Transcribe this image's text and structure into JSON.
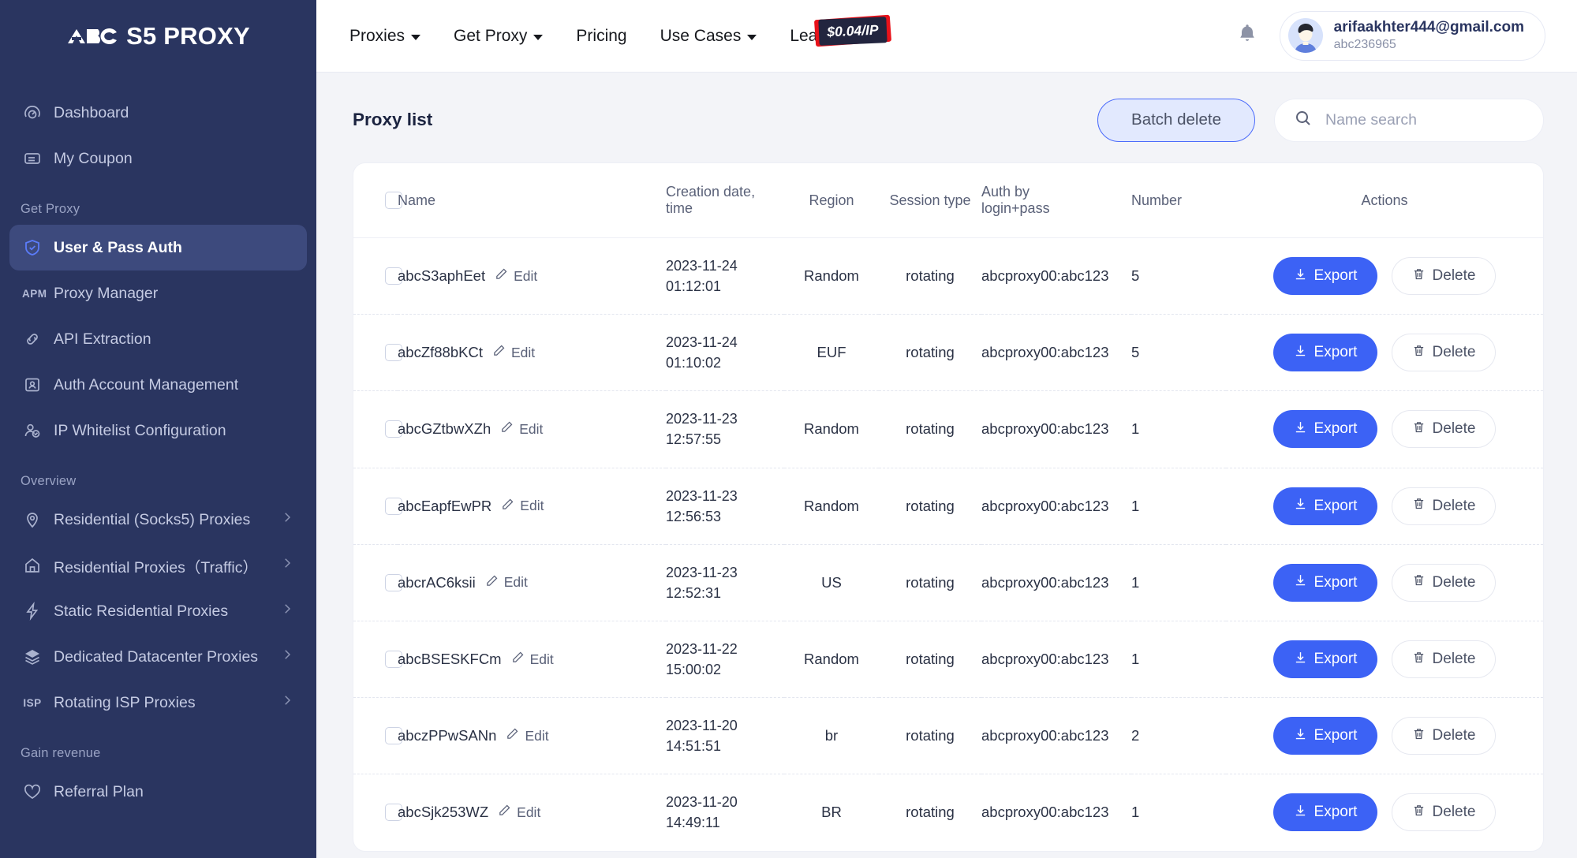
{
  "sidebar": {
    "brand": {
      "logo_text": "ABC",
      "name": "S5 PROXY"
    },
    "top_items": [
      {
        "label": "Dashboard",
        "icon": "gauge-icon"
      },
      {
        "label": "My Coupon",
        "icon": "ticket-icon"
      }
    ],
    "sections": [
      {
        "title": "Get Proxy",
        "items": [
          {
            "label": "User & Pass Auth",
            "icon": "shield-check-icon",
            "active": true,
            "chevron": false
          },
          {
            "label": "Proxy Manager",
            "icon": "apm-abbr",
            "abbr": "APM",
            "active": false,
            "chevron": false
          },
          {
            "label": "API Extraction",
            "icon": "link-icon",
            "active": false,
            "chevron": false
          },
          {
            "label": "Auth Account Management",
            "icon": "id-card-icon",
            "active": false,
            "chevron": false
          },
          {
            "label": "IP Whitelist Configuration",
            "icon": "user-check-icon",
            "active": false,
            "chevron": false
          }
        ]
      },
      {
        "title": "Overview",
        "items": [
          {
            "label": "Residential (Socks5) Proxies",
            "icon": "pin-icon",
            "active": false,
            "chevron": true
          },
          {
            "label": "Residential Proxies（Traffic）",
            "icon": "home-icon",
            "active": false,
            "chevron": true
          },
          {
            "label": "Static Residential Proxies",
            "icon": "bolt-icon",
            "active": false,
            "chevron": true
          },
          {
            "label": "Dedicated Datacenter Proxies",
            "icon": "layers-icon",
            "active": false,
            "chevron": true
          },
          {
            "label": "Rotating ISP Proxies",
            "icon": "isp-abbr",
            "abbr": "ISP",
            "active": false,
            "chevron": true
          }
        ]
      },
      {
        "title": "Gain revenue",
        "items": [
          {
            "label": "Referral Plan",
            "icon": "heart-icon",
            "active": false,
            "chevron": false
          }
        ]
      }
    ]
  },
  "topbar": {
    "nav": [
      {
        "label": "Proxies",
        "caret": true
      },
      {
        "label": "Get Proxy",
        "caret": true
      },
      {
        "label": "Pricing",
        "caret": false
      },
      {
        "label": "Use Cases",
        "caret": true
      },
      {
        "label": "Learn",
        "caret": true
      }
    ],
    "price_badge": "$0.04/IP",
    "bell_icon": "bell-icon",
    "user": {
      "email": "arifaakhter444@gmail.com",
      "account_id": "abc236965"
    }
  },
  "page": {
    "title": "Proxy list",
    "batch_delete_label": "Batch delete",
    "search_placeholder": "Name search",
    "search_value": "",
    "search_icon": "search-icon"
  },
  "table": {
    "columns": [
      "Name",
      "Creation date, time",
      "Region",
      "Session type",
      "Auth by login+pass",
      "Number",
      "Actions"
    ],
    "column_name": "Name",
    "column_date_line1": "Creation date,",
    "column_date_line2": "time",
    "column_region": "Region",
    "column_session": "Session type",
    "column_auth_line1": "Auth by",
    "column_auth_line2": "login+pass",
    "column_number": "Number",
    "column_actions": "Actions",
    "edit_label": "Edit",
    "export_label": "Export",
    "delete_label": "Delete",
    "rows": [
      {
        "name": "abcS3aphEet",
        "date": "2023-11-24",
        "time": "01:12:01",
        "region": "Random",
        "session": "rotating",
        "auth": "abcproxy00:abc123",
        "number": "5"
      },
      {
        "name": "abcZf88bKCt",
        "date": "2023-11-24",
        "time": "01:10:02",
        "region": "EUF",
        "session": "rotating",
        "auth": "abcproxy00:abc123",
        "number": "5"
      },
      {
        "name": "abcGZtbwXZh",
        "date": "2023-11-23",
        "time": "12:57:55",
        "region": "Random",
        "session": "rotating",
        "auth": "abcproxy00:abc123",
        "number": "1"
      },
      {
        "name": "abcEapfEwPR",
        "date": "2023-11-23",
        "time": "12:56:53",
        "region": "Random",
        "session": "rotating",
        "auth": "abcproxy00:abc123",
        "number": "1"
      },
      {
        "name": "abcrAC6ksii",
        "date": "2023-11-23",
        "time": "12:52:31",
        "region": "US",
        "session": "rotating",
        "auth": "abcproxy00:abc123",
        "number": "1"
      },
      {
        "name": "abcBSESKFCm",
        "date": "2023-11-22",
        "time": "15:00:02",
        "region": "Random",
        "session": "rotating",
        "auth": "abcproxy00:abc123",
        "number": "1"
      },
      {
        "name": "abczPPwSANn",
        "date": "2023-11-20",
        "time": "14:51:51",
        "region": "br",
        "session": "rotating",
        "auth": "abcproxy00:abc123",
        "number": "2"
      },
      {
        "name": "abcSjk253WZ",
        "date": "2023-11-20",
        "time": "14:49:11",
        "region": "BR",
        "session": "rotating",
        "auth": "abcproxy00:abc123",
        "number": "1"
      }
    ]
  },
  "colors": {
    "sidebar_bg": "#2a3560",
    "sidebar_active": "#3d4a7d",
    "accent_blue": "#3c62f5",
    "page_bg": "#f3f4f8",
    "badge_red": "#e8121a",
    "badge_dark": "#22253f"
  }
}
